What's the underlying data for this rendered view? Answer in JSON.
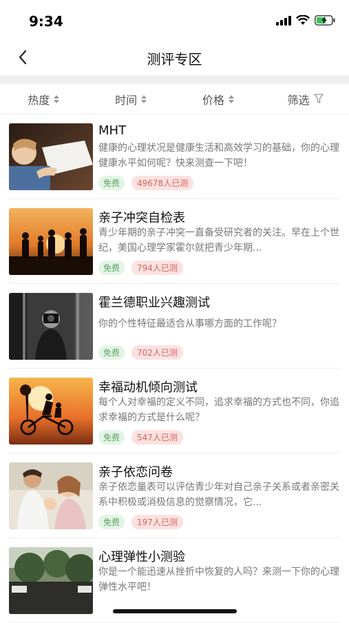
{
  "status_bar": {
    "time": "9:34",
    "icons": [
      "signal-icon",
      "wifi-icon",
      "battery-charging-icon"
    ]
  },
  "nav": {
    "title": "测评专区",
    "back_icon": "chevron-left-icon"
  },
  "filters": [
    {
      "label": "热度",
      "icon": "sort-icon"
    },
    {
      "label": "时间",
      "icon": "sort-icon"
    },
    {
      "label": "价格",
      "icon": "sort-icon"
    },
    {
      "label": "筛选",
      "icon": "filter-icon"
    }
  ],
  "items": [
    {
      "title": "MHT",
      "desc": "健康的心理状况是健康生活和高效学习的基础，你的心理健康水平如何呢？快来测查一下吧！",
      "free": "免费",
      "count": "49678人已测"
    },
    {
      "title": "亲子冲突自检表",
      "desc": "青少年期的亲子冲突一直备受研究者的关注。早在上个世纪，美国心理学家霍尔就把青少年期...",
      "free": "免费",
      "count": "794人已测"
    },
    {
      "title": "霍兰德职业兴趣测试",
      "desc": "你的个性特征最适合从事哪方面的工作呢？",
      "free": "免费",
      "count": "702人已测"
    },
    {
      "title": "幸福动机倾向测试",
      "desc": "每个人对幸福的定义不同，追求幸福的方式也不同，你追求幸福的方式是什么呢？",
      "free": "免费",
      "count": "547人已测"
    },
    {
      "title": "亲子依恋问卷",
      "desc": "亲子依恋量表可以评估青少年对自己亲子关系或者亲密关系中积极或消极信息的觉察情况，它...",
      "free": "免费",
      "count": "197人已测"
    },
    {
      "title": "心理弹性小测验",
      "desc": "你是一个能迅速从挫折中恢复的人吗？来测一下你的心理弹性水平吧！",
      "free": "",
      "count": ""
    }
  ]
}
